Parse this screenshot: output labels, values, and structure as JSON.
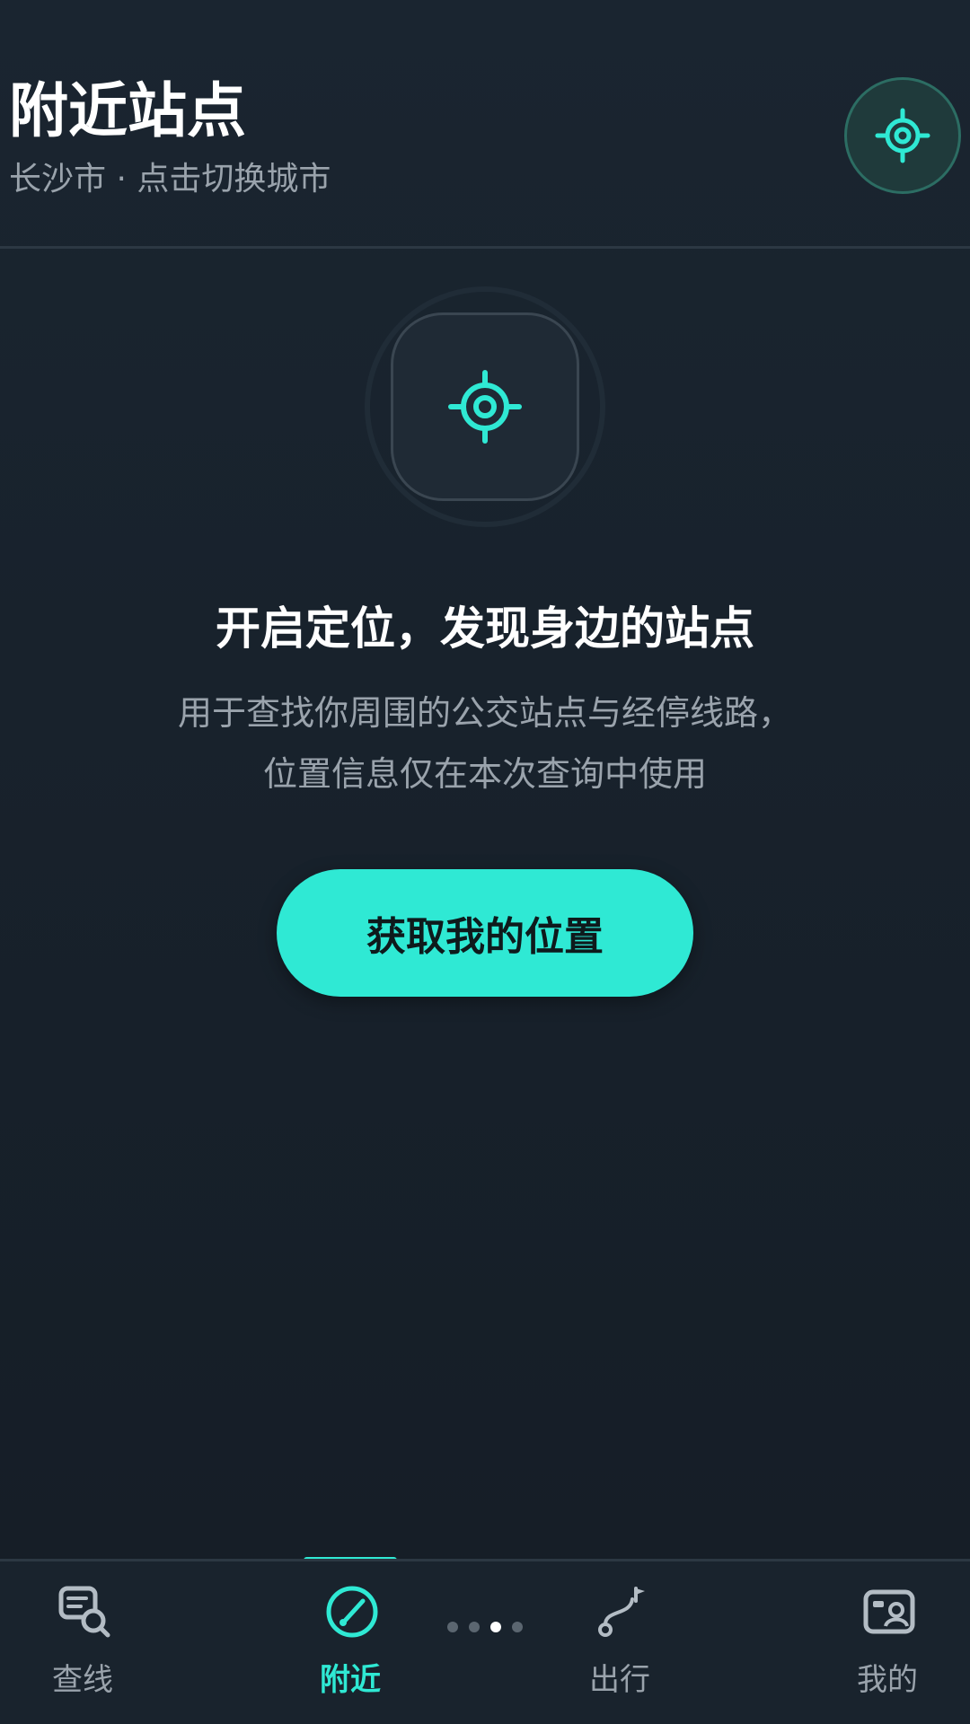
{
  "header": {
    "title": "附近站点",
    "subtitle": "长沙市 · 点击切换城市",
    "locate_button_icon": "locate-crosshair-icon"
  },
  "hero": {
    "icon": "location-crosshair-icon",
    "heading": "开启定位，发现身边的站点",
    "description_line1": "用于查找你周围的公交站点与经停线路，",
    "description_line2": "位置信息仅在本次查询中使用",
    "cta_label": "获取我的位置"
  },
  "bottom_nav": {
    "items": [
      {
        "label": "查线",
        "icon": "search-line-icon",
        "active": false
      },
      {
        "label": "附近",
        "icon": "compass-icon",
        "active": true
      },
      {
        "label": "出行",
        "icon": "route-icon",
        "active": false
      },
      {
        "label": "我的",
        "icon": "profile-card-icon",
        "active": false
      }
    ],
    "page_dots": {
      "count": 4,
      "active_index": 2
    }
  },
  "colors": {
    "accent": "#2fe9d4",
    "background": "#172029",
    "text_primary": "#ffffff",
    "text_secondary": "#9aa3ac"
  }
}
